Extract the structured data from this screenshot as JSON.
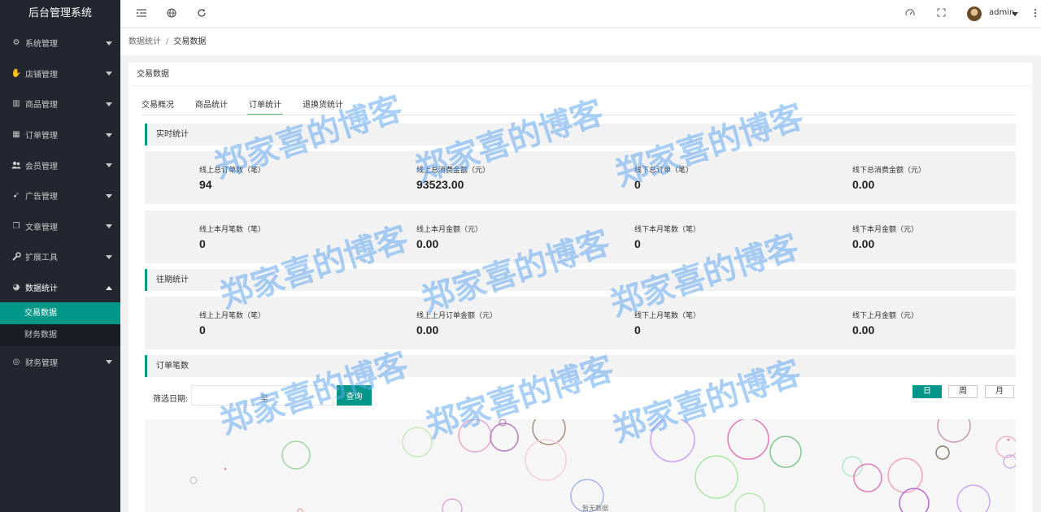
{
  "app": {
    "title": "后台管理系统"
  },
  "sidebar": {
    "items": [
      {
        "label": "系统管理",
        "icon": "gear-icon",
        "glyph": "⚙"
      },
      {
        "label": "店铺管理",
        "icon": "hand-icon",
        "glyph": "✋"
      },
      {
        "label": "商品管理",
        "icon": "chart-icon",
        "glyph": "▥"
      },
      {
        "label": "订单管理",
        "icon": "calendar-icon",
        "glyph": "▦"
      },
      {
        "label": "会员管理",
        "icon": "users-icon",
        "glyph": "👥"
      },
      {
        "label": "广告管理",
        "icon": "rocket-icon",
        "glyph": "➹"
      },
      {
        "label": "文章管理",
        "icon": "copy-icon",
        "glyph": "❐"
      },
      {
        "label": "扩展工具",
        "icon": "wrench-icon",
        "glyph": "🔧"
      },
      {
        "label": "数据统计",
        "icon": "pie-chart-icon",
        "glyph": "◕"
      }
    ],
    "sub_items": [
      {
        "label": "交易数据"
      },
      {
        "label": "财务数据"
      }
    ],
    "last_item": {
      "label": "财务管理",
      "icon": "money-icon",
      "glyph": "◎"
    }
  },
  "header": {
    "user_name": "admin"
  },
  "breadcrumb": {
    "parent": "数据统计",
    "separator": "/",
    "current": "交易数据"
  },
  "card": {
    "title": "交易数据",
    "tabs": [
      "交易概况",
      "商品统计",
      "订单统计",
      "退换货统计"
    ],
    "active_tab": "订单统计"
  },
  "sections": {
    "realtime": "实时统计",
    "history": "往期统计",
    "orders": "订单笔数"
  },
  "realtime_row1": [
    {
      "label": "线上总订单数（笔）",
      "value": "94"
    },
    {
      "label": "线上总消费金额（元）",
      "value": "93523.00"
    },
    {
      "label": "线下总订单（笔）",
      "value": "0"
    },
    {
      "label": "线下总消费金额（元）",
      "value": "0.00"
    }
  ],
  "realtime_row2": [
    {
      "label": "线上本月笔数（笔）",
      "value": "0"
    },
    {
      "label": "线上本月金额（元）",
      "value": "0.00"
    },
    {
      "label": "线下本月笔数（笔）",
      "value": "0"
    },
    {
      "label": "线下本月金额（元）",
      "value": "0.00"
    }
  ],
  "history_row": [
    {
      "label": "线上上月笔数（笔）",
      "value": "0"
    },
    {
      "label": "线上上月订单金额（元）",
      "value": "0.00"
    },
    {
      "label": "线下上月笔数（笔）",
      "value": "0"
    },
    {
      "label": "线下上月金额（元）",
      "value": "0.00"
    }
  ],
  "filter": {
    "label": "筛选日期:",
    "to_label": "至",
    "query_button": "查询",
    "periods": [
      "日",
      "周",
      "月"
    ],
    "active_period": "日"
  },
  "chart": {
    "empty_text": "暂无数据"
  },
  "watermark": {
    "text": "郑家喜的博客"
  },
  "colors": {
    "accent": "#009688",
    "sidebar_bg": "#24262f",
    "tab_underline": "#5FB878"
  }
}
